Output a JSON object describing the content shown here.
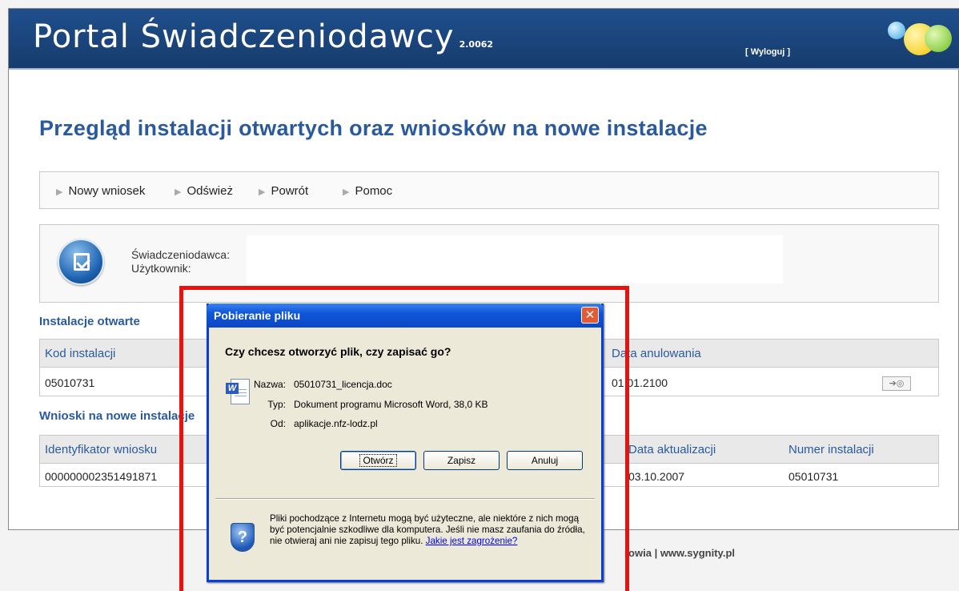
{
  "header": {
    "title": "Portal Świadczeniodawcy",
    "version": "2.0062",
    "logout": "[ Wyloguj ]"
  },
  "page_title": "Przegląd instalacji otwartych oraz wniosków na nowe instalacje",
  "toolbar": {
    "items": [
      "Nowy wniosek",
      "Odśwież",
      "Powrót",
      "Pomoc"
    ]
  },
  "info": {
    "provider_label": "Świadczeniodawca:",
    "user_label": "Użytkownik:"
  },
  "open_installations": {
    "title": "Instalacje otwarte",
    "columns": [
      "Kod instalacji",
      "Data anulowania"
    ],
    "rows": [
      {
        "code": "05010731",
        "cancel_date": "01.01.2100"
      }
    ]
  },
  "requests": {
    "title": "Wnioski na nowe instalacje",
    "columns": [
      "Identyfikator wniosku",
      "Data aktualizacji",
      "Numer instalacji"
    ],
    "rows": [
      {
        "id": "000000002351491871",
        "updated": "03.10.2007",
        "installation": "05010731"
      }
    ]
  },
  "footer": {
    "text": "rowia | www.sygnity.pl"
  },
  "dialog": {
    "title": "Pobieranie pliku",
    "question": "Czy chcesz otworzyć plik, czy zapisać go?",
    "name_label": "Nazwa:",
    "name_value": "05010731_licencja.doc",
    "type_label": "Typ:",
    "type_value": "Dokument programu Microsoft Word, 38,0 KB",
    "from_label": "Od:",
    "from_value": "aplikacje.nfz-lodz.pl",
    "buttons": {
      "open": "Otwórz",
      "save": "Zapisz",
      "cancel": "Anuluj"
    },
    "warning_text": "Pliki pochodzące z Internetu mogą być użyteczne, ale niektóre z nich mogą być potencjalnie szkodliwe dla komputera. Jeśli nie masz zaufania do źródła, nie otwieraj ani nie zapisuj tego pliku.",
    "warning_link": "Jakie jest zagrożenie?"
  },
  "colors": {
    "header_bg": "#1f4f8c",
    "title_blue": "#2a5a9b",
    "highlight_red": "#e8120f",
    "dialog_bg": "#ece9d8",
    "dialog_title": "#0a47c6"
  },
  "icons": {
    "provider": "checkmark-document-icon",
    "file": "word-document-icon",
    "security": "shield-question-icon",
    "row_action": "arrow-disk-icon"
  }
}
